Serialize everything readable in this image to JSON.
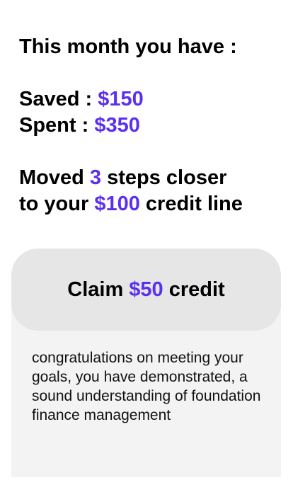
{
  "summary": {
    "heading": "This month you have :",
    "saved_label": "Saved : ",
    "saved_amount": "$150",
    "spent_label": "Spent : ",
    "spent_amount": "$350",
    "moved_prefix": "Moved ",
    "moved_steps": "3",
    "moved_suffix": " steps closer",
    "credit_prefix": "to your ",
    "credit_amount": "$100",
    "credit_suffix": " credit line"
  },
  "claim": {
    "prefix": "Claim ",
    "amount": "$50",
    "suffix": " credit",
    "message": "congratulations on meeting your goals, you have demonstrated, a sound understanding of foundation finance management"
  },
  "colors": {
    "accent": "#5b2ff0",
    "card_background": "#f3f3f3",
    "button_background": "#e6e6e6"
  }
}
